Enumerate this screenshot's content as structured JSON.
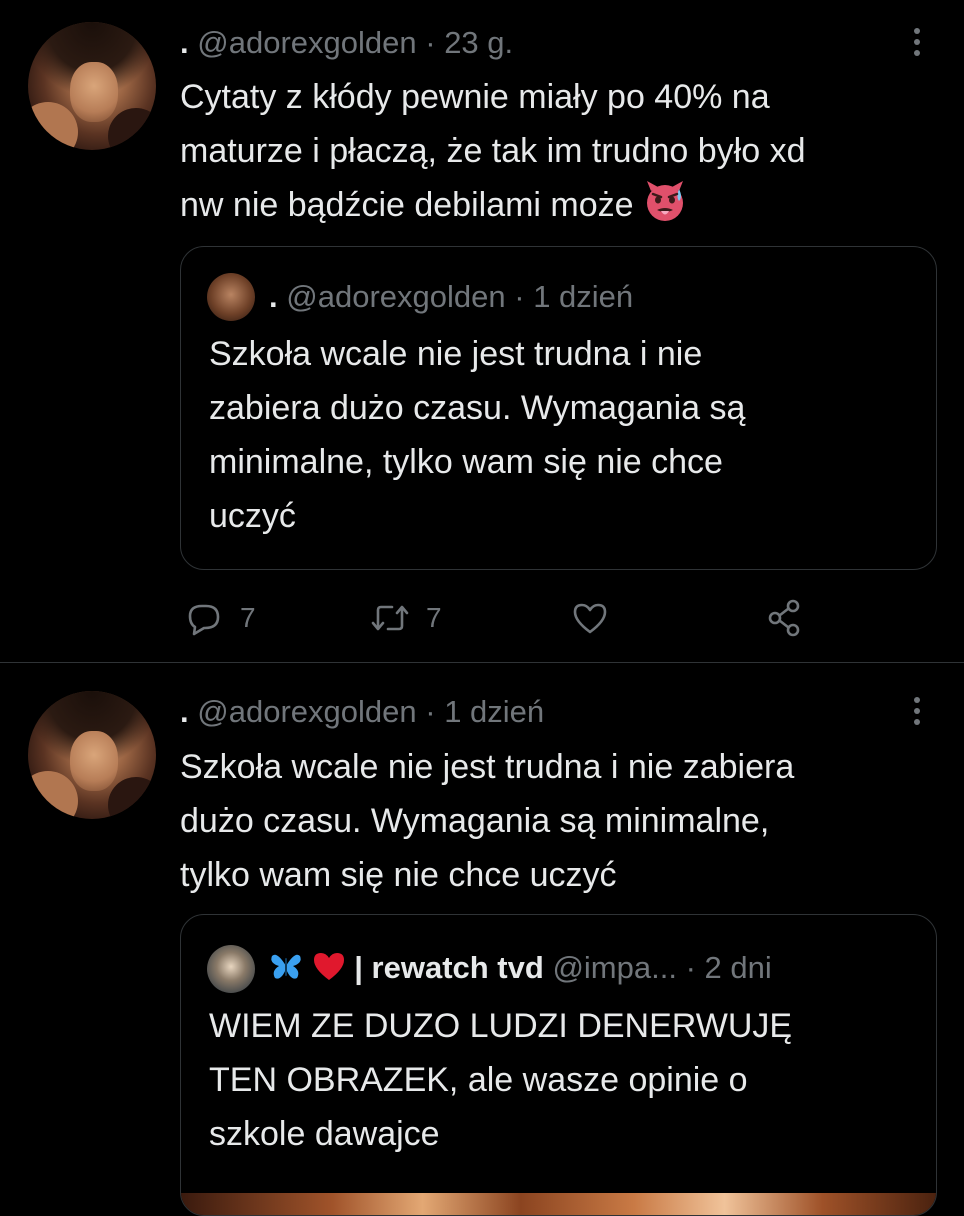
{
  "tweet1": {
    "display_name": ".",
    "handle": "@adorexgolden",
    "separator": "·",
    "time": "23 g.",
    "text_line1": "Cytaty z kłódy pewnie miały po 40% na",
    "text_line2": "maturze i płaczą, że tak im trudno było xd",
    "text_line3": "nw nie bądźcie debilami może",
    "emoji": "hot-face-devil-emoji",
    "quote": {
      "display_name": ".",
      "handle": "@adorexgolden",
      "separator": "·",
      "time": "1 dzień",
      "text_line1": "Szkoła wcale nie jest trudna i nie",
      "text_line2": "zabiera dużo czasu. Wymagania są",
      "text_line3": "minimalne, tylko wam się nie chce",
      "text_line4": "uczyć"
    },
    "actions": {
      "reply_count": "7",
      "retweet_count": "7"
    }
  },
  "tweet2": {
    "display_name": ".",
    "handle": "@adorexgolden",
    "separator": "·",
    "time": "1 dzień",
    "text_line1": "Szkoła wcale nie jest trudna i nie zabiera",
    "text_line2": "dużo czasu. Wymagania są minimalne,",
    "text_line3": "tylko wam się nie chce uczyć",
    "quote": {
      "name_emojis": [
        "butterfly-emoji",
        "red-heart-emoji"
      ],
      "name": "| rewatch tvd",
      "handle": "@impa...",
      "separator": "·",
      "time": "2 dni",
      "text_line1": "WIEM ZE DUZO LUDZI DENERWUJĘ",
      "text_line2": "TEN OBRAZEK, ale wasze opinie o",
      "text_line3": "szkole dawajce"
    }
  },
  "colors": {
    "background": "#000000",
    "text": "#e7e9ea",
    "secondary": "#71767b",
    "border": "#2f3336",
    "emoji_pink": "#e0506b",
    "heart": "#e0182d",
    "butterfly": "#3aa0f0"
  }
}
